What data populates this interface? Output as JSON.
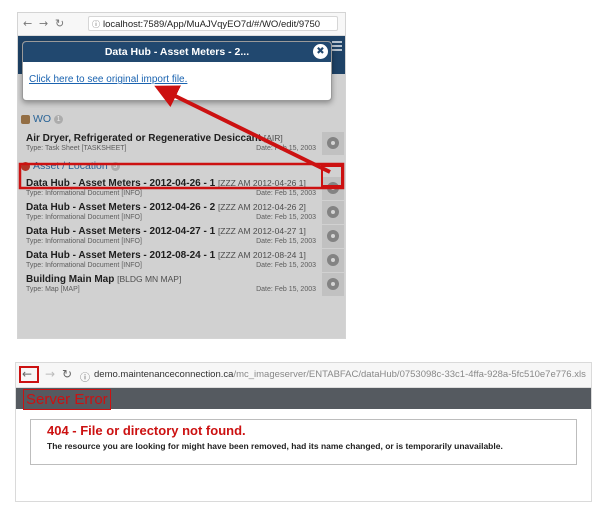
{
  "top": {
    "url": "localhost:7589/App/MuAJVqyEO7d/#/WO/edit/9750",
    "modal": {
      "title": "Data Hub - Asset Meters - 2...",
      "close_glyph": "✖",
      "link": "Click here to see original import file."
    },
    "wo_section": {
      "label": "WO",
      "count": "1"
    },
    "asset_section": {
      "label": "Asset / Location",
      "count": "5"
    },
    "wo_rows": [
      {
        "title": "Air Dryer, Refrigerated or Regenerative Desiccant",
        "code": "[AIR]",
        "type": "Type: Task Sheet [TASKSHEET]",
        "date": "Date: Feb 15, 2003"
      }
    ],
    "asset_rows": [
      {
        "title": "Data Hub - Asset Meters - 2012-04-26 - 1",
        "code": "[ZZZ AM 2012-04-26 1]",
        "type": "Type: Informational Document [INFO]",
        "date": "Date: Feb 15, 2003"
      },
      {
        "title": "Data Hub - Asset Meters - 2012-04-26 - 2",
        "code": "[ZZZ AM 2012-04-26 2]",
        "type": "Type: Informational Document [INFO]",
        "date": "Date: Feb 15, 2003"
      },
      {
        "title": "Data Hub - Asset Meters - 2012-04-27 - 1",
        "code": "[ZZZ AM 2012-04-27 1]",
        "type": "Type: Informational Document [INFO]",
        "date": "Date: Feb 15, 2003"
      },
      {
        "title": "Data Hub - Asset Meters - 2012-08-24 - 1",
        "code": "[ZZZ AM 2012-08-24 1]",
        "type": "Type: Informational Document [INFO]",
        "date": "Date: Feb 15, 2003"
      },
      {
        "title": "Building Main Map",
        "code": "[BLDG MN MAP]",
        "type": "Type: Map [MAP]",
        "date": "Date: Feb 15, 2003"
      }
    ]
  },
  "bottom": {
    "url_host": "demo.maintenanceconnection.ca",
    "url_path": "/mc_imageserver/ENTABFAC/dataHub/0753098c-33c1-4ffa-928a-5fc510e7e776.xls",
    "server_error_title": "Server Error",
    "error_heading": "404 - File or directory not found.",
    "error_message": "The resource you are looking for might have been removed, had its name changed, or is temporarily unavailable."
  },
  "colors": {
    "header_navy": "#21486f",
    "link_blue": "#1a63b0",
    "annotation_red": "#cc1111",
    "error_bar": "#555a60"
  }
}
